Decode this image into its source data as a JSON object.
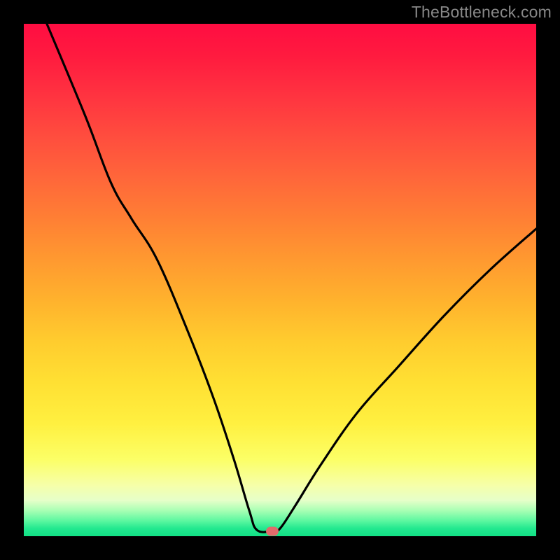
{
  "watermark": "TheBottleneck.com",
  "marker": {
    "x_pct": 48.5,
    "y_pct": 99.1
  },
  "colors": {
    "frame": "#000000",
    "watermark": "#888888",
    "curve": "#000000",
    "marker": "#e06b6b"
  },
  "chart_data": {
    "type": "line",
    "title": "",
    "xlabel": "",
    "ylabel": "",
    "xlim": [
      0,
      100
    ],
    "ylim": [
      0,
      100
    ],
    "note": "Axes are unlabeled; values are percentage positions within the plot area (0,0 = top-left, 100,100 = bottom-right). The curve descends steeply from top-left, flattens briefly at the bottom near x≈45–49, then rises toward the right edge mid-height.",
    "series": [
      {
        "name": "bottleneck-curve",
        "points": [
          {
            "x": 4.5,
            "y": 0.0
          },
          {
            "x": 12.0,
            "y": 18.0
          },
          {
            "x": 17.0,
            "y": 31.0
          },
          {
            "x": 21.0,
            "y": 38.0
          },
          {
            "x": 26.0,
            "y": 46.0
          },
          {
            "x": 32.0,
            "y": 60.0
          },
          {
            "x": 37.0,
            "y": 73.0
          },
          {
            "x": 41.0,
            "y": 85.0
          },
          {
            "x": 44.0,
            "y": 95.0
          },
          {
            "x": 45.5,
            "y": 98.8
          },
          {
            "x": 48.5,
            "y": 99.0
          },
          {
            "x": 50.0,
            "y": 98.5
          },
          {
            "x": 53.0,
            "y": 94.0
          },
          {
            "x": 58.0,
            "y": 86.0
          },
          {
            "x": 65.0,
            "y": 76.0
          },
          {
            "x": 73.0,
            "y": 67.0
          },
          {
            "x": 82.0,
            "y": 57.0
          },
          {
            "x": 91.0,
            "y": 48.0
          },
          {
            "x": 100.0,
            "y": 40.0
          }
        ]
      }
    ],
    "marker_point": {
      "x": 48.5,
      "y": 99.1
    }
  }
}
